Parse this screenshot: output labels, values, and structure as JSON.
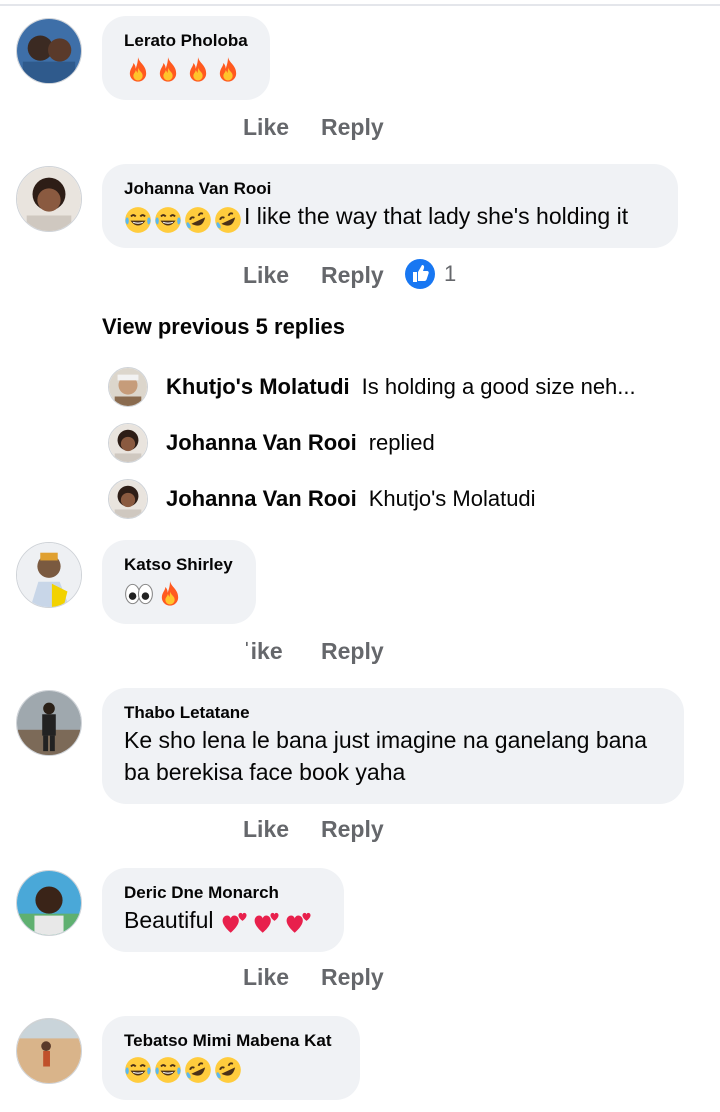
{
  "comments": [
    {
      "author": "Lerato Pholoba",
      "text": "",
      "emojis": [
        "fire",
        "fire",
        "fire",
        "fire"
      ],
      "like": "Like",
      "reply": "Reply"
    },
    {
      "author": "Johanna Van Rooi",
      "text": "I like the way that lady she's holding it",
      "emojis": [
        "joy",
        "joy",
        "rofl",
        "rofl"
      ],
      "like": "Like",
      "reply": "Reply",
      "reaction_count": "1"
    },
    {
      "author": "Katso Shirley",
      "text": "",
      "emojis": [
        "eyes",
        "fire"
      ],
      "like": "ˈike",
      "reply": "Reply"
    },
    {
      "author": "Thabo Letatane",
      "text_line1": "Ke sho lena le bana just imagine na ganelang bana",
      "text_line2": "ba berekisa face book yaha",
      "like": "Like",
      "reply": "Reply"
    },
    {
      "author": "Deric Dne Monarch",
      "text": "Beautiful",
      "emojis": [
        "hearts",
        "hearts",
        "hearts"
      ],
      "like": "Like",
      "reply": "Reply"
    },
    {
      "author": "Tebatso Mimi Mabena Kat",
      "text": "",
      "emojis": [
        "joy",
        "joy",
        "rofl",
        "rofl"
      ]
    }
  ],
  "thread": {
    "view_previous": "View previous 5 replies",
    "replies": [
      {
        "author": "Khutjo's Molatudi",
        "text": "Is holding a good size neh..."
      },
      {
        "author": "Johanna Van Rooi",
        "text": "replied"
      },
      {
        "author": "Johanna Van Rooi",
        "text": "Khutjo's Molatudi"
      }
    ]
  },
  "colors": {
    "bubble": "#f0f2f5",
    "action_text": "#65676b",
    "like_blue": "#1877f2"
  },
  "icons": [
    "fire-emoji",
    "joy-emoji",
    "rofl-emoji",
    "eyes-emoji",
    "hearts-emoji",
    "like-reaction-icon"
  ]
}
